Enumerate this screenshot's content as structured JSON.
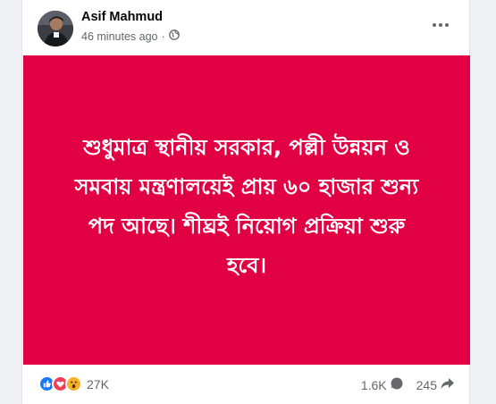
{
  "post": {
    "author": "Asif Mahmud",
    "time": "46 minutes ago",
    "separator": "·",
    "audience_icon": "globe-icon",
    "body_lines": [
      "শুধুমাত্র স্থানীয় সরকার, পল্লী উন্নয়ন ও",
      "সমবায় মন্ত্রণালয়েই প্রায় ৬০ হাজার শুন্য",
      "পদ আছে। শীঘ্রই নিয়োগ প্রক্রিয়া শুরু",
      "হবে।"
    ],
    "background_color": "#e10043"
  },
  "footer": {
    "reactions": [
      "like-icon",
      "love-icon",
      "wow-icon"
    ],
    "reaction_count": "27K",
    "comment_count": "1.6K",
    "share_count": "245"
  }
}
